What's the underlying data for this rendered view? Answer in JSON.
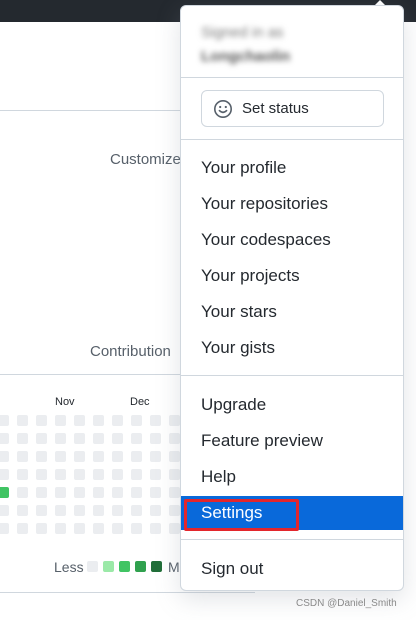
{
  "background": {
    "customize_text": "Customize",
    "contributions_text": "Contribution",
    "months": [
      "Nov",
      "Dec"
    ],
    "legend": {
      "less_label": "Less",
      "more_label": "M",
      "colors": [
        "#ebedf0",
        "#9be9a8",
        "#40c463",
        "#30a14e",
        "#216e39"
      ]
    },
    "green_cell_color": "#40c463"
  },
  "menu": {
    "signed_in_label": "Signed in as",
    "username": "Longchaolin",
    "set_status_label": "Set status",
    "set_status_icon": "smiley-icon",
    "section1": [
      "Your profile",
      "Your repositories",
      "Your codespaces",
      "Your projects",
      "Your stars",
      "Your gists"
    ],
    "section2": [
      "Upgrade",
      "Feature preview",
      "Help",
      "Settings"
    ],
    "selected_item": "Settings",
    "sign_out_label": "Sign out",
    "accent_color": "#0969da",
    "highlight_color": "#e3262c"
  },
  "watermark": "CSDN @Daniel_Smith"
}
